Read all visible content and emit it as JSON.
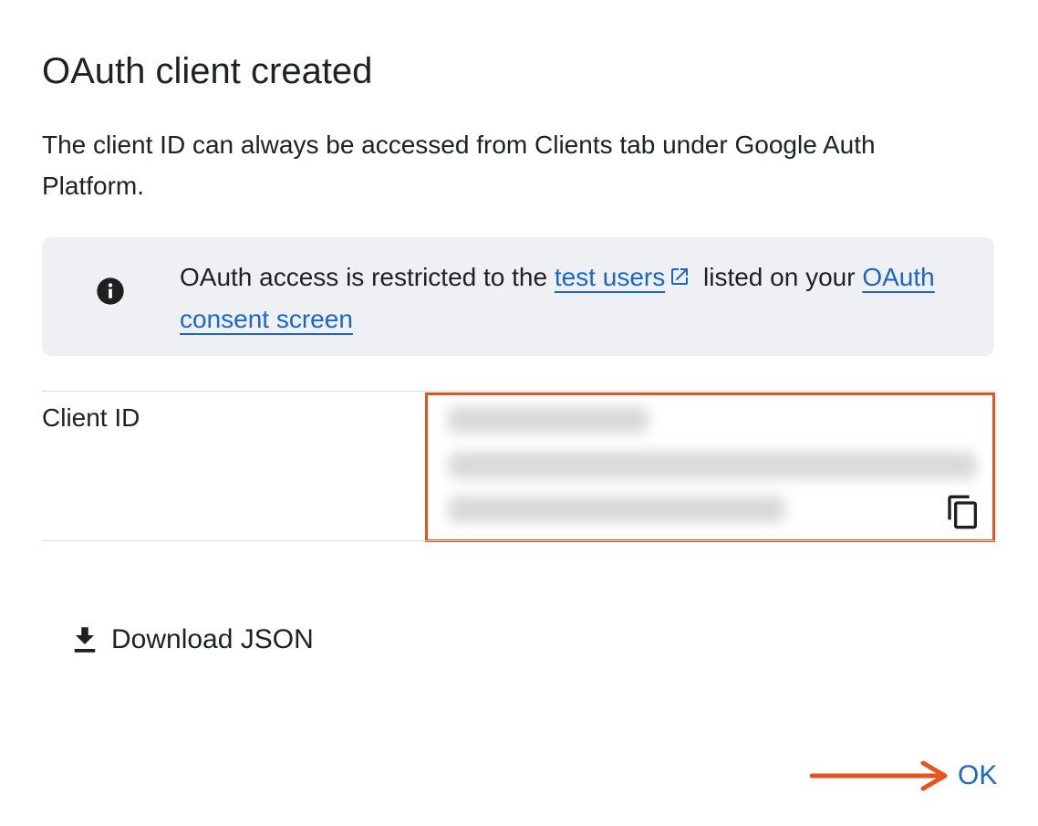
{
  "dialog": {
    "title": "OAuth client created",
    "description": "The client ID can always be accessed from Clients tab under Google Auth Platform."
  },
  "info_banner": {
    "icon": "info-icon",
    "text_before_link1": "OAuth access is restricted to the ",
    "link1_label": "test users",
    "link1_icon": "external-link-icon",
    "text_between": " listed on your ",
    "link2_label": "OAuth consent screen"
  },
  "client": {
    "label": "Client ID",
    "value_state": "blurred",
    "copy_icon": "copy-icon"
  },
  "actions": {
    "download_icon": "download-icon",
    "download_label": "Download JSON",
    "ok_label": "OK"
  },
  "annotations": {
    "highlight_color": "#e8521f",
    "arrow_color": "#e8521f"
  },
  "colors": {
    "link": "#1a66c9",
    "text": "#202124",
    "banner_bg": "#eef0f4",
    "divider": "#dadce0"
  }
}
